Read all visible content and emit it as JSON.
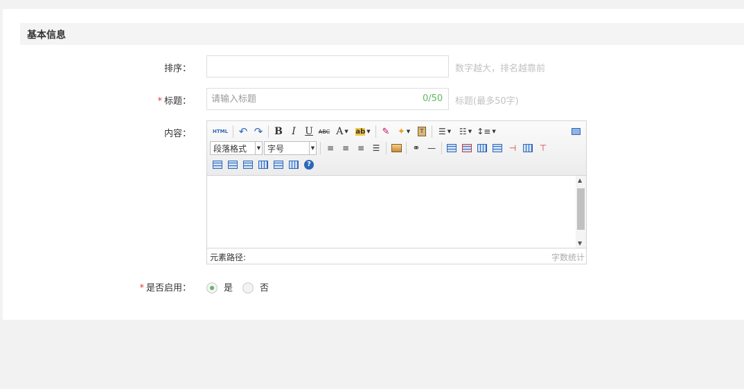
{
  "section": {
    "title": "基本信息"
  },
  "form": {
    "sort": {
      "label": "排序：",
      "value": "",
      "placeholder": "",
      "hint": "数字越大，排名越靠前"
    },
    "title": {
      "required_mark": "*",
      "label": "标题：",
      "value": "",
      "placeholder": "请输入标题",
      "counter": "0/50",
      "hint": "标题(最多50字)"
    },
    "content": {
      "label": "内容：",
      "toolbar": {
        "html_label": "HTML",
        "paragraph_format": "段落格式",
        "font_size": "字号",
        "icons": [
          "html-source-icon",
          "undo-icon",
          "redo-icon",
          "bold-icon",
          "italic-icon",
          "underline-icon",
          "strikethrough-icon",
          "font-color-icon",
          "background-color-icon",
          "eraser-icon",
          "format-painter-icon",
          "paste-plain-icon",
          "ordered-list-icon",
          "unordered-list-icon",
          "line-height-icon",
          "fullscreen-icon",
          "align-left-icon",
          "align-center-icon",
          "align-right-icon",
          "align-justify-icon",
          "image-icon",
          "find-replace-icon",
          "horizontal-rule-icon",
          "insert-table-icon",
          "delete-table-icon",
          "insert-caption-icon",
          "insert-row-icon",
          "delete-row-icon",
          "insert-col-icon",
          "delete-col-icon",
          "merge-cells-icon",
          "merge-right-icon",
          "merge-down-icon",
          "split-cells-icon",
          "split-rows-icon",
          "split-cols-icon",
          "help-icon"
        ]
      },
      "statusbar": {
        "path_label": "元素路径:",
        "word_count": "字数统计"
      }
    },
    "enabled": {
      "required_mark": "*",
      "label": "是否启用：",
      "options": [
        {
          "label": "是",
          "selected": true
        },
        {
          "label": "否",
          "selected": false
        }
      ]
    }
  },
  "colors": {
    "accent_green": "#5fb85f",
    "required_red": "#e4393c",
    "hint_gray": "#c2c2c2"
  }
}
